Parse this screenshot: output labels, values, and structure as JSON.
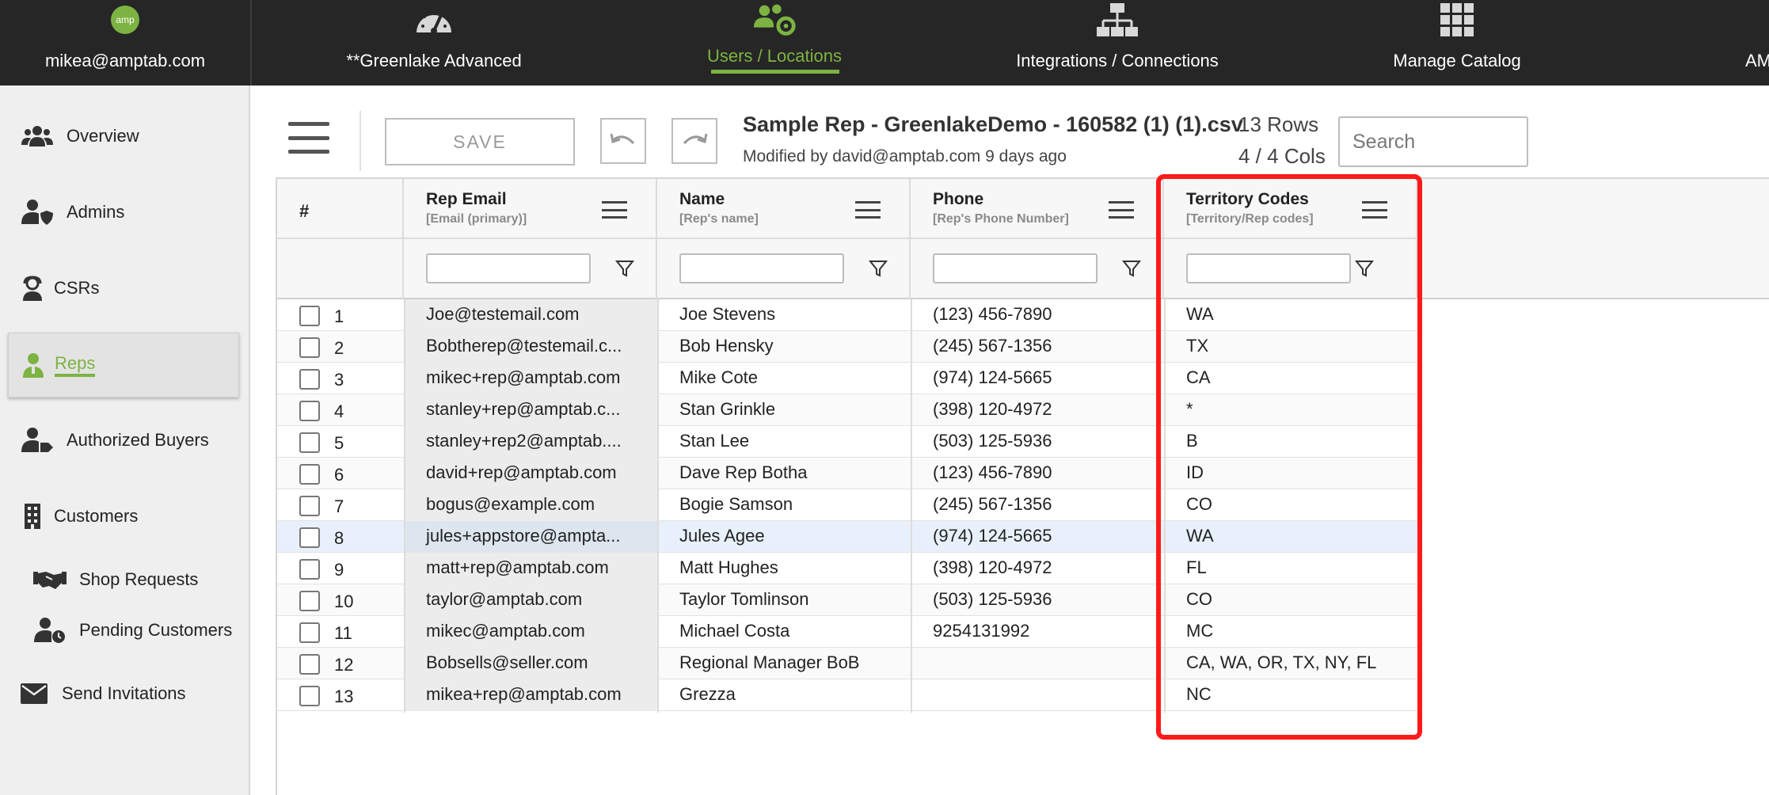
{
  "topnav": {
    "user_email": "mikea@amptab.com",
    "logo_text": "amp",
    "items": [
      {
        "label": "**Greenlake Advanced",
        "icon": "dashboard-gauge-icon"
      },
      {
        "label": "Users / Locations",
        "icon": "users-gear-icon",
        "active": true
      },
      {
        "label": "Integrations / Connections",
        "icon": "network-icon"
      },
      {
        "label": "Manage Catalog",
        "icon": "grid-icon"
      },
      {
        "label": "AM"
      }
    ]
  },
  "sidebar": {
    "items": [
      {
        "label": "Overview",
        "icon": "users-group-icon"
      },
      {
        "label": "Admins",
        "icon": "user-shield-icon"
      },
      {
        "label": "CSRs",
        "icon": "headset-user-icon"
      },
      {
        "label": "Reps",
        "icon": "rep-user-icon",
        "active": true
      },
      {
        "label": "Authorized Buyers",
        "icon": "user-tag-icon"
      },
      {
        "label": "Customers",
        "icon": "building-icon"
      },
      {
        "label": "Shop Requests",
        "icon": "handshake-icon"
      },
      {
        "label": "Pending Customers",
        "icon": "user-clock-icon"
      },
      {
        "label": "Send Invitations",
        "icon": "envelope-icon"
      }
    ]
  },
  "toolbar": {
    "save_label": "SAVE",
    "file_title": "Sample Rep - GreenlakeDemo - 160582 (1) (1).csv",
    "modified_text": "Modified by david@amptab.com 9 days ago",
    "rows_text": "13 Rows",
    "cols_text": "4 / 4 Cols",
    "search_placeholder": "Search"
  },
  "grid": {
    "index_header": "#",
    "columns": [
      {
        "title": "Rep Email",
        "subtitle": "[Email (primary)]"
      },
      {
        "title": "Name",
        "subtitle": "[Rep's name]"
      },
      {
        "title": "Phone",
        "subtitle": "[Rep's Phone Number]"
      },
      {
        "title": "Territory Codes",
        "subtitle": "[Territory/Rep codes]"
      }
    ],
    "rows": [
      {
        "num": "1",
        "email": "Joe@testemail.com",
        "name": "Joe Stevens",
        "phone": "(123) 456-7890",
        "territory": "WA"
      },
      {
        "num": "2",
        "email": "Bobtherep@testemail.c...",
        "name": "Bob Hensky",
        "phone": "(245) 567-1356",
        "territory": "TX"
      },
      {
        "num": "3",
        "email": "mikec+rep@amptab.com",
        "name": "Mike Cote",
        "phone": "(974) 124-5665",
        "territory": "CA"
      },
      {
        "num": "4",
        "email": "stanley+rep@amptab.c...",
        "name": "Stan Grinkle",
        "phone": "(398) 120-4972",
        "territory": "*"
      },
      {
        "num": "5",
        "email": "stanley+rep2@amptab....",
        "name": "Stan Lee",
        "phone": "(503) 125-5936",
        "territory": "B"
      },
      {
        "num": "6",
        "email": "david+rep@amptab.com",
        "name": "Dave Rep Botha",
        "phone": "(123) 456-7890",
        "territory": "ID"
      },
      {
        "num": "7",
        "email": "bogus@example.com",
        "name": "Bogie Samson",
        "phone": "(245) 567-1356",
        "territory": "CO"
      },
      {
        "num": "8",
        "email": "jules+appstore@ampta...",
        "name": "Jules Agee",
        "phone": "(974) 124-5665",
        "territory": "WA",
        "selected": true
      },
      {
        "num": "9",
        "email": "matt+rep@amptab.com",
        "name": "Matt Hughes",
        "phone": "(398) 120-4972",
        "territory": "FL"
      },
      {
        "num": "10",
        "email": "taylor@amptab.com",
        "name": "Taylor Tomlinson",
        "phone": "(503) 125-5936",
        "territory": "CO"
      },
      {
        "num": "11",
        "email": "mikec@amptab.com",
        "name": "Michael Costa",
        "phone": "9254131992",
        "territory": "MC"
      },
      {
        "num": "12",
        "email": "Bobsells@seller.com",
        "name": "Regional Manager BoB",
        "phone": "",
        "territory": "CA, WA, OR, TX, NY, FL"
      },
      {
        "num": "13",
        "email": "mikea+rep@amptab.com",
        "name": "Grezza",
        "phone": "",
        "territory": "NC"
      }
    ]
  },
  "colors": {
    "accent": "#7cb342",
    "topnav_bg": "#262626",
    "highlight": "#ff1a1a"
  }
}
